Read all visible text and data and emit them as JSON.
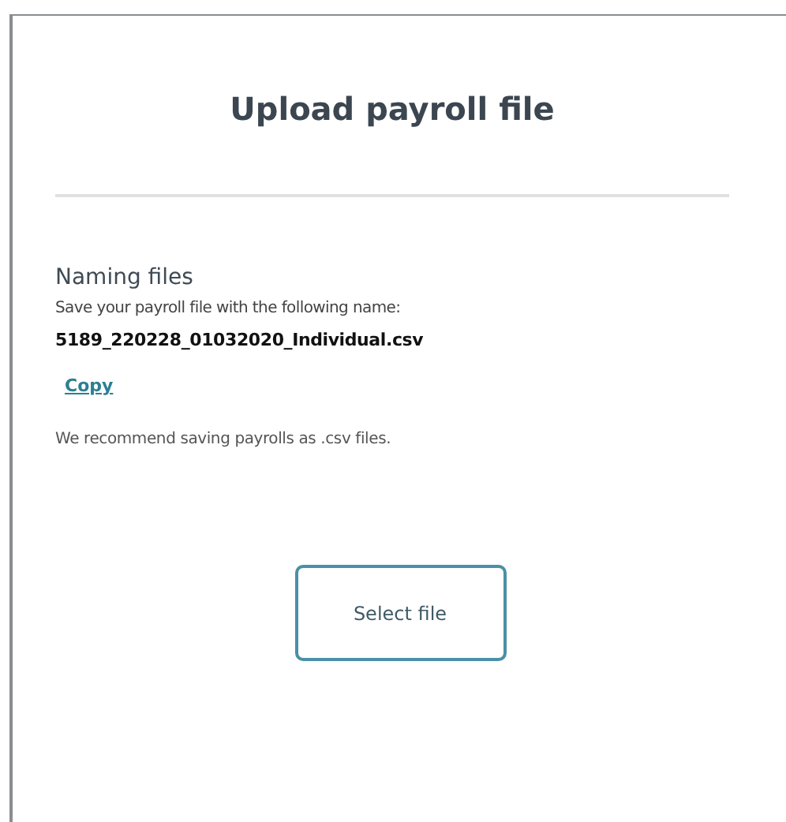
{
  "title": "Upload payroll file",
  "naming": {
    "heading": "Naming files",
    "instruction": "Save your payroll file with the following name:",
    "filename": "5189_220228_01032020_Individual.csv",
    "copy_link": "Copy",
    "recommendation": "We recommend saving payrolls as .csv files."
  },
  "buttons": [
    "Select file"
  ]
}
